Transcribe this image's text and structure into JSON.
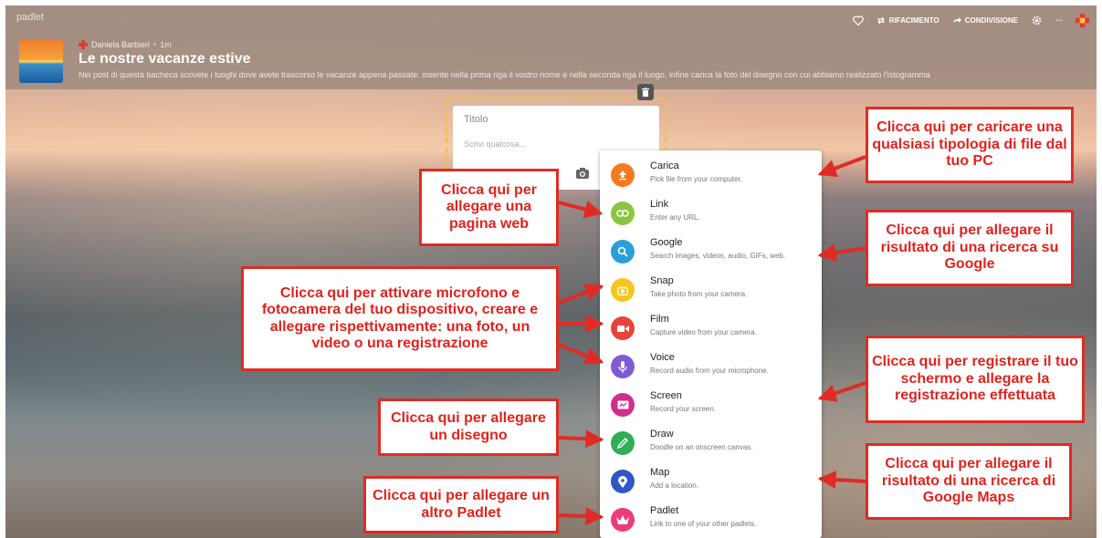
{
  "app": {
    "brand": "padlet"
  },
  "toolbar": {
    "remake_label": "RIFACIMENTO",
    "share_label": "CONDIVISIONE",
    "more_label": "···"
  },
  "board": {
    "author": "Daniela Barbieri",
    "time": "1m",
    "title": "Le nostre vacanze estive",
    "description": "Nei post di questa bacheca scrivete i luoghi dove avete trascorso le vacanze appena passate: inserite nella prima riga il vostro nome e nella seconda riga il luogo, infine carica la foto del disegno con cui abbiamo realizzato l'istogramma"
  },
  "post": {
    "title_placeholder": "Titolo",
    "body_placeholder": "Scrivi qualcosa..."
  },
  "menu": {
    "items": [
      {
        "label": "Carica",
        "sub": "Pick file from your computer.",
        "icon": "upload-icon",
        "color": "#f47a1f"
      },
      {
        "label": "Link",
        "sub": "Enter any URL.",
        "icon": "link-icon",
        "color": "#8bc53f"
      },
      {
        "label": "Google",
        "sub": "Search images, videos, audio, GIFs, web.",
        "icon": "search-icon",
        "color": "#2a9fd8"
      },
      {
        "label": "Snap",
        "sub": "Take photo from your camera.",
        "icon": "camera-icon",
        "color": "#f7c51e"
      },
      {
        "label": "Film",
        "sub": "Capture video from your camera.",
        "icon": "video-icon",
        "color": "#e8433a"
      },
      {
        "label": "Voice",
        "sub": "Record audio from your microphone.",
        "icon": "microphone-icon",
        "color": "#7d5bd6"
      },
      {
        "label": "Screen",
        "sub": "Record your screen.",
        "icon": "screen-icon",
        "color": "#d02d8e"
      },
      {
        "label": "Draw",
        "sub": "Doodle on an onscreen canvas.",
        "icon": "pen-icon",
        "color": "#2fae57"
      },
      {
        "label": "Map",
        "sub": "Add a location.",
        "icon": "map-pin-icon",
        "color": "#2f57c8"
      },
      {
        "label": "Padlet",
        "sub": "Link to one of your other padlets.",
        "icon": "padlet-icon",
        "color": "#ec3b7b"
      }
    ]
  },
  "callouts": {
    "upload": "Clicca qui per caricare una qualsiasi tipologia di file dal tuo PC",
    "link": "Clicca qui per allegare una pagina web",
    "google": "Clicca qui per allegare il risultato di una ricerca su Google",
    "media": "Clicca qui per attivare microfono e fotocamera del tuo dispositivo, creare e allegare rispettivamente: una foto, un video o una registrazione",
    "screen": "Clicca qui per registrare il tuo schermo e allegare la registrazione effettuata",
    "draw": "Clicca qui per allegare un disegno",
    "map": "Clicca qui per allegare il risultato di una ricerca di Google Maps",
    "padlet": "Clicca qui per allegare un altro Padlet"
  },
  "colors": {
    "callout_red": "#e02b25",
    "accent": "#f0c048"
  }
}
